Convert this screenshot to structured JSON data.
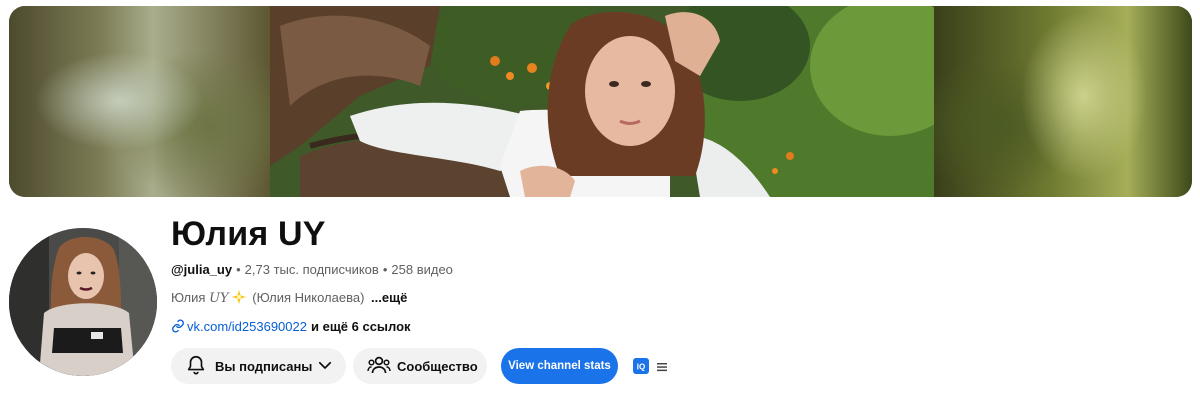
{
  "channel": {
    "name": "Юлия UY",
    "handle": "@julia_uy",
    "subscribers": "2,73 тыс. подписчиков",
    "videos": "258 видео",
    "description_prefix": "Юлия",
    "description_script": "UY",
    "description_suffix": "(Юлия Николаева)",
    "description_more": "...ещё",
    "link_text": "vk.com/id253690022",
    "more_links": "и ещё 6 ссылок"
  },
  "buttons": {
    "subscribed_label": "Вы подписаны",
    "community_label": "Сообщество",
    "stats_label": "View channel stats"
  },
  "icons": {
    "bell": "bell-icon",
    "chevron": "chevron-down-icon",
    "people": "people-icon",
    "link": "link-icon",
    "extension": "extension-icon",
    "menu": "menu-icon",
    "sparkle": "sparkle-icon"
  },
  "colors": {
    "stats_button": "#1a73e8",
    "link": "#065fd4",
    "chip_bg": "#f2f2f2"
  }
}
